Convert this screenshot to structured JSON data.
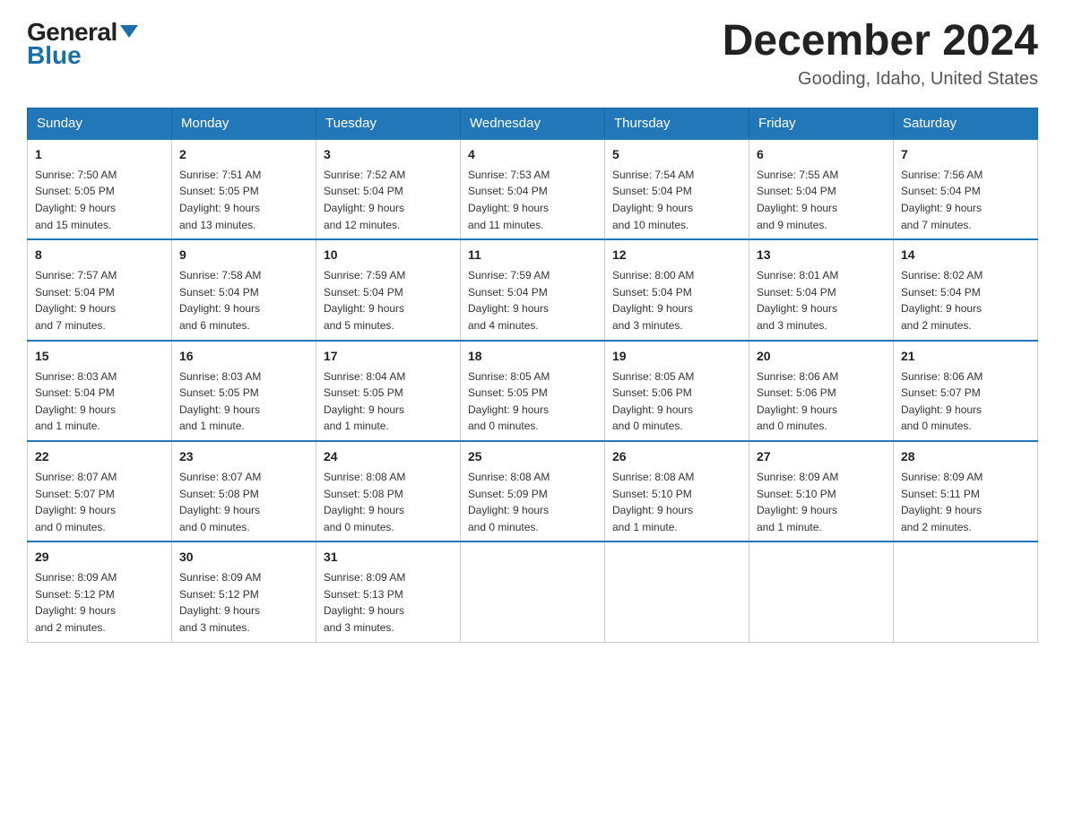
{
  "header": {
    "logo": {
      "general": "General",
      "blue": "Blue",
      "arrow": "▲"
    },
    "title": "December 2024",
    "subtitle": "Gooding, Idaho, United States"
  },
  "days_of_week": [
    "Sunday",
    "Monday",
    "Tuesday",
    "Wednesday",
    "Thursday",
    "Friday",
    "Saturday"
  ],
  "weeks": [
    [
      {
        "day": "1",
        "sunrise": "7:50 AM",
        "sunset": "5:05 PM",
        "daylight": "9 hours and 15 minutes."
      },
      {
        "day": "2",
        "sunrise": "7:51 AM",
        "sunset": "5:05 PM",
        "daylight": "9 hours and 13 minutes."
      },
      {
        "day": "3",
        "sunrise": "7:52 AM",
        "sunset": "5:04 PM",
        "daylight": "9 hours and 12 minutes."
      },
      {
        "day": "4",
        "sunrise": "7:53 AM",
        "sunset": "5:04 PM",
        "daylight": "9 hours and 11 minutes."
      },
      {
        "day": "5",
        "sunrise": "7:54 AM",
        "sunset": "5:04 PM",
        "daylight": "9 hours and 10 minutes."
      },
      {
        "day": "6",
        "sunrise": "7:55 AM",
        "sunset": "5:04 PM",
        "daylight": "9 hours and 9 minutes."
      },
      {
        "day": "7",
        "sunrise": "7:56 AM",
        "sunset": "5:04 PM",
        "daylight": "9 hours and 7 minutes."
      }
    ],
    [
      {
        "day": "8",
        "sunrise": "7:57 AM",
        "sunset": "5:04 PM",
        "daylight": "9 hours and 7 minutes."
      },
      {
        "day": "9",
        "sunrise": "7:58 AM",
        "sunset": "5:04 PM",
        "daylight": "9 hours and 6 minutes."
      },
      {
        "day": "10",
        "sunrise": "7:59 AM",
        "sunset": "5:04 PM",
        "daylight": "9 hours and 5 minutes."
      },
      {
        "day": "11",
        "sunrise": "7:59 AM",
        "sunset": "5:04 PM",
        "daylight": "9 hours and 4 minutes."
      },
      {
        "day": "12",
        "sunrise": "8:00 AM",
        "sunset": "5:04 PM",
        "daylight": "9 hours and 3 minutes."
      },
      {
        "day": "13",
        "sunrise": "8:01 AM",
        "sunset": "5:04 PM",
        "daylight": "9 hours and 3 minutes."
      },
      {
        "day": "14",
        "sunrise": "8:02 AM",
        "sunset": "5:04 PM",
        "daylight": "9 hours and 2 minutes."
      }
    ],
    [
      {
        "day": "15",
        "sunrise": "8:03 AM",
        "sunset": "5:04 PM",
        "daylight": "9 hours and 1 minute."
      },
      {
        "day": "16",
        "sunrise": "8:03 AM",
        "sunset": "5:05 PM",
        "daylight": "9 hours and 1 minute."
      },
      {
        "day": "17",
        "sunrise": "8:04 AM",
        "sunset": "5:05 PM",
        "daylight": "9 hours and 1 minute."
      },
      {
        "day": "18",
        "sunrise": "8:05 AM",
        "sunset": "5:05 PM",
        "daylight": "9 hours and 0 minutes."
      },
      {
        "day": "19",
        "sunrise": "8:05 AM",
        "sunset": "5:06 PM",
        "daylight": "9 hours and 0 minutes."
      },
      {
        "day": "20",
        "sunrise": "8:06 AM",
        "sunset": "5:06 PM",
        "daylight": "9 hours and 0 minutes."
      },
      {
        "day": "21",
        "sunrise": "8:06 AM",
        "sunset": "5:07 PM",
        "daylight": "9 hours and 0 minutes."
      }
    ],
    [
      {
        "day": "22",
        "sunrise": "8:07 AM",
        "sunset": "5:07 PM",
        "daylight": "9 hours and 0 minutes."
      },
      {
        "day": "23",
        "sunrise": "8:07 AM",
        "sunset": "5:08 PM",
        "daylight": "9 hours and 0 minutes."
      },
      {
        "day": "24",
        "sunrise": "8:08 AM",
        "sunset": "5:08 PM",
        "daylight": "9 hours and 0 minutes."
      },
      {
        "day": "25",
        "sunrise": "8:08 AM",
        "sunset": "5:09 PM",
        "daylight": "9 hours and 0 minutes."
      },
      {
        "day": "26",
        "sunrise": "8:08 AM",
        "sunset": "5:10 PM",
        "daylight": "9 hours and 1 minute."
      },
      {
        "day": "27",
        "sunrise": "8:09 AM",
        "sunset": "5:10 PM",
        "daylight": "9 hours and 1 minute."
      },
      {
        "day": "28",
        "sunrise": "8:09 AM",
        "sunset": "5:11 PM",
        "daylight": "9 hours and 2 minutes."
      }
    ],
    [
      {
        "day": "29",
        "sunrise": "8:09 AM",
        "sunset": "5:12 PM",
        "daylight": "9 hours and 2 minutes."
      },
      {
        "day": "30",
        "sunrise": "8:09 AM",
        "sunset": "5:12 PM",
        "daylight": "9 hours and 3 minutes."
      },
      {
        "day": "31",
        "sunrise": "8:09 AM",
        "sunset": "5:13 PM",
        "daylight": "9 hours and 3 minutes."
      },
      null,
      null,
      null,
      null
    ]
  ],
  "labels": {
    "sunrise": "Sunrise:",
    "sunset": "Sunset:",
    "daylight": "Daylight:"
  }
}
